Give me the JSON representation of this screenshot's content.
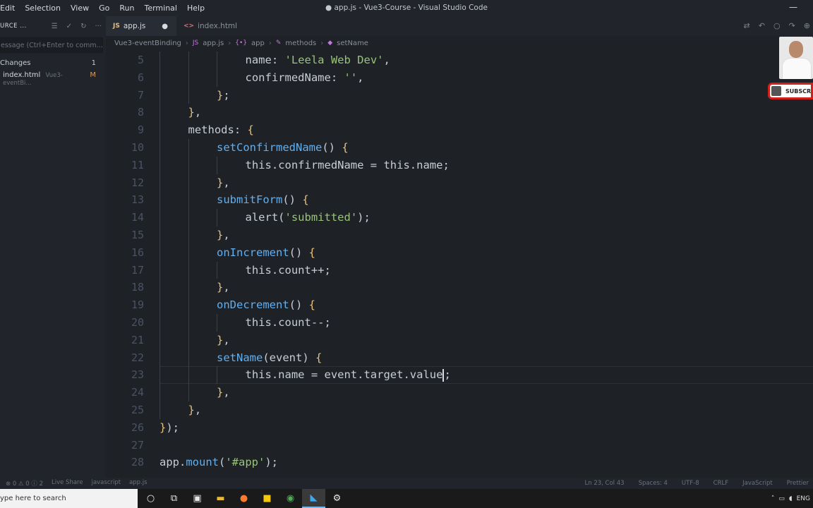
{
  "menu": [
    "Edit",
    "Selection",
    "View",
    "Go",
    "Run",
    "Terminal",
    "Help"
  ],
  "window_title": "● app.js - Vue3-Course - Visual Studio Code",
  "sidebar": {
    "title": "URCE ...",
    "commit_placeholder": "essage (Ctrl+Enter to comm...",
    "changes_label": "Changes",
    "changes_count": "1",
    "file_name": "index.html",
    "file_dir": "Vue3-eventBi...",
    "file_status": "M"
  },
  "tabs": [
    {
      "label": "app.js",
      "icon": "JS",
      "modified": "●"
    },
    {
      "label": "index.html",
      "icon": "<>"
    }
  ],
  "breadcrumb": [
    "Vue3-eventBinding",
    "app.js",
    "app",
    "methods",
    "setName"
  ],
  "code": {
    "lines": [
      {
        "n": "5",
        "indent": 3,
        "html": "name: <span class='k-str'>'Leela Web Dev'</span>,"
      },
      {
        "n": "6",
        "indent": 3,
        "html": "confirmedName: <span class='k-str'>''</span>,"
      },
      {
        "n": "7",
        "indent": 2,
        "html": "<span class='k-br'>}</span>;"
      },
      {
        "n": "8",
        "indent": 1,
        "html": "<span class='k-br'>}</span>,"
      },
      {
        "n": "9",
        "indent": 1,
        "html": "methods: <span class='k-br'>{</span>"
      },
      {
        "n": "10",
        "indent": 2,
        "html": "<span class='k-fn'>setConfirmedName</span>() <span class='k-br'>{</span>"
      },
      {
        "n": "11",
        "indent": 3,
        "html": "this.confirmedName = this.name;"
      },
      {
        "n": "12",
        "indent": 2,
        "html": "<span class='k-br'>}</span>,"
      },
      {
        "n": "13",
        "indent": 2,
        "html": "<span class='k-fn'>submitForm</span>() <span class='k-br'>{</span>"
      },
      {
        "n": "14",
        "indent": 3,
        "html": "alert(<span class='k-str'>'submitted'</span>);"
      },
      {
        "n": "15",
        "indent": 2,
        "html": "<span class='k-br'>}</span>,"
      },
      {
        "n": "16",
        "indent": 2,
        "html": "<span class='k-fn'>onIncrement</span>() <span class='k-br'>{</span>"
      },
      {
        "n": "17",
        "indent": 3,
        "html": "this.count++;"
      },
      {
        "n": "18",
        "indent": 2,
        "html": "<span class='k-br'>}</span>,"
      },
      {
        "n": "19",
        "indent": 2,
        "html": "<span class='k-fn'>onDecrement</span>() <span class='k-br'>{</span>"
      },
      {
        "n": "20",
        "indent": 3,
        "html": "this.count--;"
      },
      {
        "n": "21",
        "indent": 2,
        "html": "<span class='k-br'>}</span>,"
      },
      {
        "n": "22",
        "indent": 2,
        "html": "<span class='k-fn'>setName</span>(event) <span class='k-br'>{</span>"
      },
      {
        "n": "23",
        "indent": 3,
        "html": "this.name = event.target.value<span class='cursor'></span>;",
        "current": true
      },
      {
        "n": "24",
        "indent": 2,
        "html": "<span class='k-br'>}</span>,"
      },
      {
        "n": "25",
        "indent": 1,
        "html": "<span class='k-br'>}</span>,"
      },
      {
        "n": "26",
        "indent": 0,
        "html": "<span class='k-br'>}</span>);"
      },
      {
        "n": "27",
        "indent": 0,
        "html": ""
      },
      {
        "n": "28",
        "indent": 0,
        "html": "app.<span class='k-fn'>mount</span>(<span class='k-str'>'#app'</span>);"
      }
    ]
  },
  "overlay": {
    "subscribe_label": "SUBSCRI"
  },
  "statusbar": {
    "left": [
      "⊗ 0 ⚠ 0 ⓘ 2",
      "Live Share",
      "javascript",
      "app.js"
    ],
    "right": [
      "Ln 23, Col 43",
      "Spaces: 4",
      "UTF-8",
      "CRLF",
      "JavaScript",
      "Prettier"
    ]
  },
  "taskbar": {
    "search_placeholder": "ype here to search",
    "tray_lang": "ENG"
  }
}
